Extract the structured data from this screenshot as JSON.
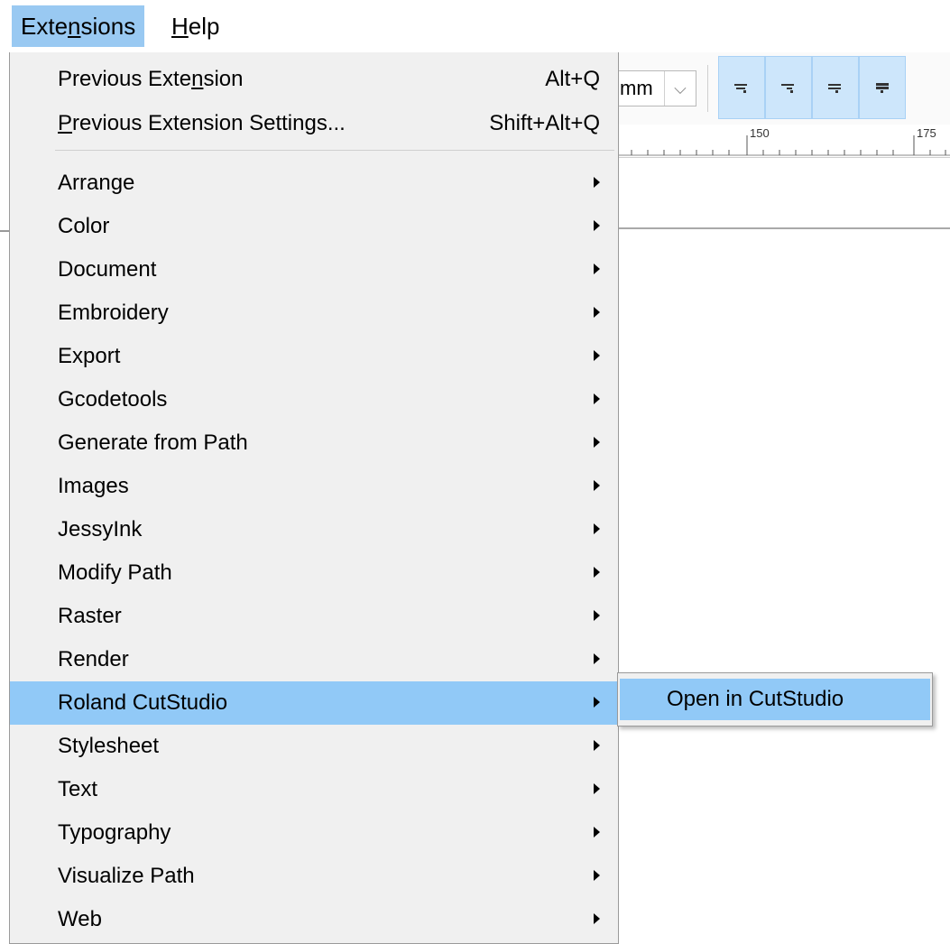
{
  "menubar": {
    "items": [
      {
        "label_pre": "Exte",
        "mnemonic": "n",
        "label_post": "sions"
      },
      {
        "label_pre": "",
        "mnemonic": "H",
        "label_post": "elp"
      }
    ]
  },
  "toolbar": {
    "unit_value": "mm",
    "unit_arrow": "⌵"
  },
  "ruler": {
    "labels": [
      "150",
      "175"
    ]
  },
  "menu": {
    "top_items": [
      {
        "label_pre": "Previous Exte",
        "mnemonic": "n",
        "label_post": "sion",
        "shortcut": "Alt+Q"
      },
      {
        "label_pre": "",
        "mnemonic": "P",
        "label_post": "revious Extension Settings...",
        "shortcut": "Shift+Alt+Q"
      }
    ],
    "items": [
      {
        "label": "Arrange"
      },
      {
        "label": "Color"
      },
      {
        "label": "Document"
      },
      {
        "label": "Embroidery"
      },
      {
        "label": "Export"
      },
      {
        "label": "Gcodetools"
      },
      {
        "label": "Generate from Path"
      },
      {
        "label": "Images"
      },
      {
        "label": "JessyInk"
      },
      {
        "label": "Modify Path"
      },
      {
        "label": "Raster"
      },
      {
        "label": "Render"
      },
      {
        "label": "Roland CutStudio"
      },
      {
        "label": "Stylesheet"
      },
      {
        "label": "Text"
      },
      {
        "label": "Typography"
      },
      {
        "label": "Visualize Path"
      },
      {
        "label": "Web"
      }
    ]
  },
  "submenu": {
    "items": [
      {
        "label": "Open in CutStudio"
      }
    ]
  },
  "colors": {
    "highlight": "#91c9f7",
    "menubar_active": "#99c9f2",
    "menu_bg": "#f0f0f0"
  }
}
